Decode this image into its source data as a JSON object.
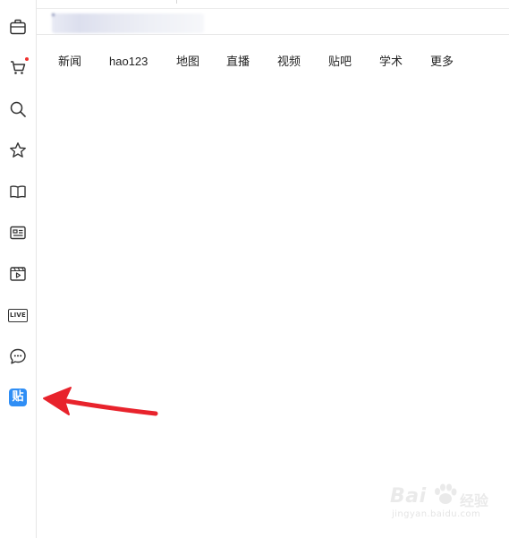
{
  "sidebar": {
    "items": [
      {
        "name": "briefcase-icon"
      },
      {
        "name": "cart-icon",
        "notification": true
      },
      {
        "name": "search-icon"
      },
      {
        "name": "star-icon"
      },
      {
        "name": "book-icon"
      },
      {
        "name": "id-card-icon"
      },
      {
        "name": "video-icon"
      },
      {
        "name": "live-icon",
        "label": "LIVE"
      },
      {
        "name": "chat-icon"
      },
      {
        "name": "tieba-icon",
        "label": "贴",
        "color": "#2f8ef5"
      }
    ]
  },
  "nav": {
    "links": [
      "新闻",
      "hao123",
      "地图",
      "直播",
      "视频",
      "贴吧",
      "学术",
      "更多"
    ]
  },
  "annotation": {
    "arrow_color": "#e8232c"
  },
  "watermark": {
    "brand": "Bai",
    "brand_suffix": "经验",
    "url": "jingyan.baidu.com"
  },
  "colors": {
    "notification_dot": "#f0302e",
    "tieba_blue": "#2f8ef5",
    "icon": "#333333"
  }
}
